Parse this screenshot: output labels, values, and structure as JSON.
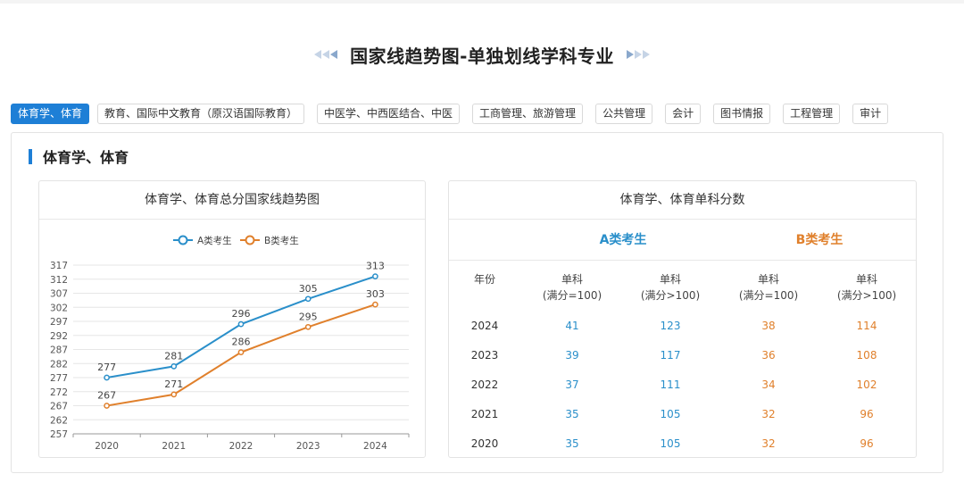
{
  "page": {
    "title": "国家线趋势图-单独划线学科专业"
  },
  "tabs": [
    {
      "label": "体育学、体育",
      "active": true
    },
    {
      "label": "教育、国际中文教育（原汉语国际教育）",
      "active": false
    },
    {
      "label": "中医学、中西医结合、中医",
      "active": false
    },
    {
      "label": "工商管理、旅游管理",
      "active": false
    },
    {
      "label": "公共管理",
      "active": false
    },
    {
      "label": "会计",
      "active": false
    },
    {
      "label": "图书情报",
      "active": false
    },
    {
      "label": "工程管理",
      "active": false
    },
    {
      "label": "审计",
      "active": false
    }
  ],
  "section": {
    "title": "体育学、体育"
  },
  "colors": {
    "accent": "#1e7fd6",
    "series_a": "#2a8fca",
    "series_b": "#e0802c"
  },
  "chart_card": {
    "title": "体育学、体育总分国家线趋势图"
  },
  "chart_data": {
    "type": "line",
    "title": "体育学、体育总分国家线趋势图",
    "categories": [
      "2020",
      "2021",
      "2022",
      "2023",
      "2024"
    ],
    "series": [
      {
        "name": "A类考生",
        "values": [
          277,
          281,
          296,
          305,
          313
        ]
      },
      {
        "name": "B类考生",
        "values": [
          267,
          271,
          286,
          295,
          303
        ]
      }
    ],
    "yticks": [
      257,
      262,
      267,
      272,
      277,
      282,
      287,
      292,
      297,
      302,
      307,
      312,
      317
    ],
    "ylim": [
      257,
      317
    ],
    "xlabel": "",
    "ylabel": "",
    "grid": true,
    "legend": "top-center"
  },
  "table_card": {
    "title": "体育学、体育单科分数",
    "group_a": "A类考生",
    "group_b": "B类考生",
    "headers": [
      {
        "line1": "年份",
        "line2": ""
      },
      {
        "line1": "单科",
        "line2": "(满分=100)"
      },
      {
        "line1": "单科",
        "line2": "(满分>100)"
      },
      {
        "line1": "单科",
        "line2": "(满分=100)"
      },
      {
        "line1": "单科",
        "line2": "(满分>100)"
      }
    ],
    "rows": [
      [
        "2024",
        "41",
        "123",
        "38",
        "114"
      ],
      [
        "2023",
        "39",
        "117",
        "36",
        "108"
      ],
      [
        "2022",
        "37",
        "111",
        "34",
        "102"
      ],
      [
        "2021",
        "35",
        "105",
        "32",
        "96"
      ],
      [
        "2020",
        "35",
        "105",
        "32",
        "96"
      ]
    ]
  }
}
